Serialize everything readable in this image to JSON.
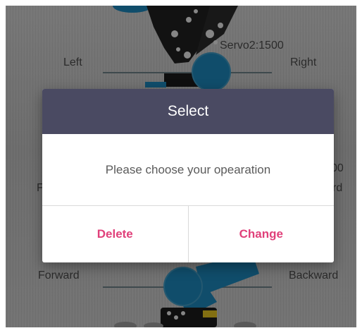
{
  "servo_readout": "Servo2:1500",
  "control_labels": {
    "left": "Left",
    "right": "Right",
    "forward": "Forward",
    "backward": "Backward",
    "clipped_left": "F",
    "clipped_right_value": "00",
    "clipped_right_label": "rd"
  },
  "dialog": {
    "title": "Select",
    "message": "Please choose your opearation",
    "delete_label": "Delete",
    "change_label": "Change"
  },
  "colors": {
    "dialog_header": "#4a4a62",
    "action_text": "#e0407a",
    "slider_knob": "#1d86b8"
  },
  "icons": [
    "robot-arm-top-graphic",
    "robot-arm-bottom-graphic"
  ]
}
